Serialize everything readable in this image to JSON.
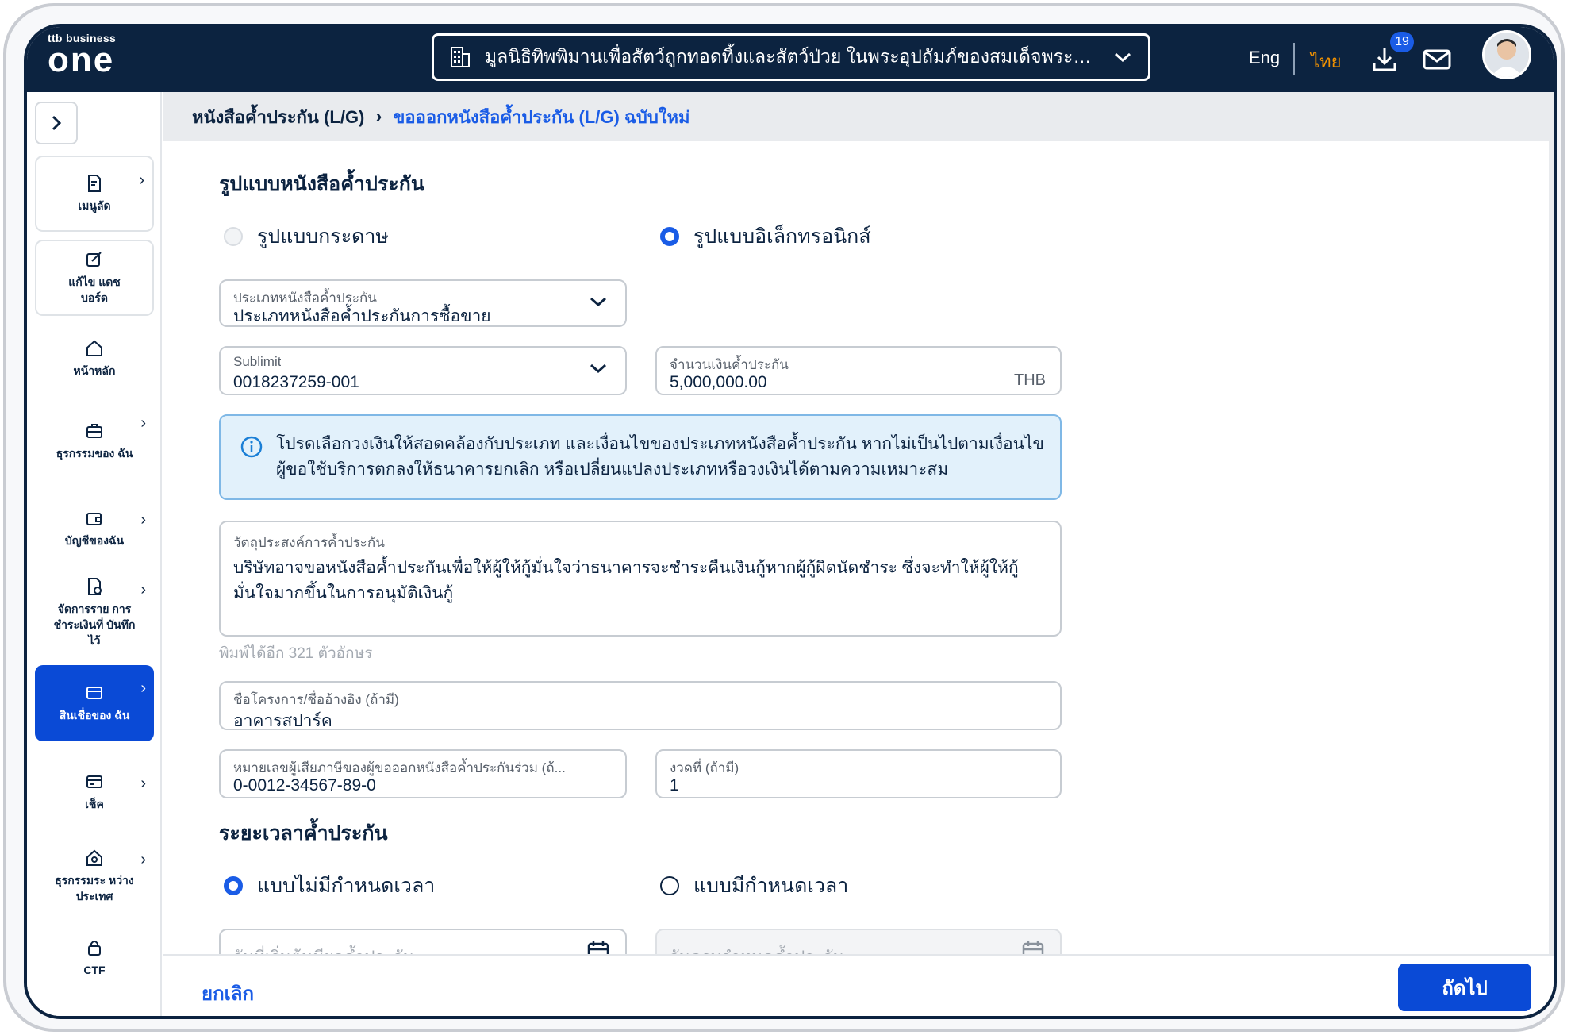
{
  "header": {
    "logo_small": "ttb business",
    "logo_big": "one",
    "company": "มูลนิธิทิพพิมานเพื่อสัตว์ถูกทอดทิ้งและสัตว์ป่วย ในพระอุปถัมภ์ของสมเด็จพระนางเจ้า...",
    "lang_en": "Eng",
    "lang_th": "ไทย",
    "download_count": "19"
  },
  "sidebar": {
    "items": [
      {
        "label": "เมนูลัด",
        "icon": "shortcut-doc-icon"
      },
      {
        "label": "แก้ไข แดชบอร์ด",
        "icon": "edit-icon"
      },
      {
        "label": "หน้าหลัก",
        "icon": "home-icon"
      },
      {
        "label": "ธุรกรรมของ ฉัน",
        "icon": "briefcase-icon"
      },
      {
        "label": "บัญชีของฉัน",
        "icon": "wallet-icon"
      },
      {
        "label": "จัดการราย การชำระเงินที่ บันทึกไว้",
        "icon": "saved-payment-icon"
      },
      {
        "label": "สินเชื่อของ ฉัน",
        "icon": "card-icon"
      },
      {
        "label": "เช็ค",
        "icon": "cheque-icon"
      },
      {
        "label": "ธุรกรรมระ หว่างประเทศ",
        "icon": "international-icon"
      },
      {
        "label": "CTF",
        "icon": "lock-icon"
      }
    ]
  },
  "breadcrumb": {
    "parent": "หนังสือค้ำประกัน (L/G)",
    "current": "ขอออกหนังสือค้ำประกัน (L/G) ฉบับใหม่"
  },
  "form": {
    "format_title": "รูปแบบหนังสือค้ำประกัน",
    "format_paper": "รูปแบบกระดาษ",
    "format_electronic": "รูปแบบอิเล็กทรอนิกส์",
    "lg_type_label": "ประเภทหนังสือค้ำประกัน",
    "lg_type_value": "ประเภทหนังสือค้ำประกันการซื้อขาย",
    "sublimit_label": "Sublimit",
    "sublimit_value": "0018237259-001",
    "amount_label": "จำนวนเงินค้ำประกัน",
    "amount_value": "5,000,000.00",
    "amount_unit": "THB",
    "info_text": "โปรดเลือกวงเงินให้สอดคล้องกับประเภท และเงื่อนไขของประเภทหนังสือค้ำประกัน หากไม่เป็นไปตามเงื่อนไข ผู้ขอใช้บริการตกลงให้ธนาคารยกเลิก หรือเปลี่ยนแปลงประเภทหรือวงเงินได้ตามความเหมาะสม",
    "purpose_label": "วัตถุประสงค์การค้ำประกัน",
    "purpose_value": "บริษัทอาจขอหนังสือค้ำประกันเพื่อให้ผู้ให้กู้มั่นใจว่าธนาคารจะชำระคืนเงินกู้หากผู้กู้ผิดนัดชำระ ซึ่งจะทำให้ผู้ให้กู้มั่นใจมากขึ้นในการอนุมัติเงินกู้",
    "char_count": "พิมพ์ได้อีก 321 ตัวอักษร",
    "project_label": "ชื่อโครงการ/ชื่ออ้างอิง (ถ้ามี)",
    "project_value": "อาคารสปาร์ค",
    "taxid_label": "หมายเลขผู้เสียภาษีของผู้ขอออกหนังสือค้ำประกันร่วม (ถ้...",
    "taxid_value": "0-0012-34567-89-0",
    "installment_label": "งวดที่ (ถ้ามี)",
    "installment_value": "1",
    "period_title": "ระยะเวลาค้ำประกัน",
    "period_open": "แบบไม่มีกำหนดเวลา",
    "period_fixed": "แบบมีกำหนดเวลา",
    "start_date_placeholder": "วันที่เริ่มต้นมีผลค้ำประกัน",
    "end_date_placeholder": "วันครบกำหนดค้ำประกัน"
  },
  "footer": {
    "cancel": "ยกเลิก",
    "next": "ถัดไป"
  },
  "colors": {
    "navy": "#0c2340",
    "primary": "#0a4ad6",
    "accent_orange": "#f29200",
    "info_bg": "#e2f1fb"
  }
}
